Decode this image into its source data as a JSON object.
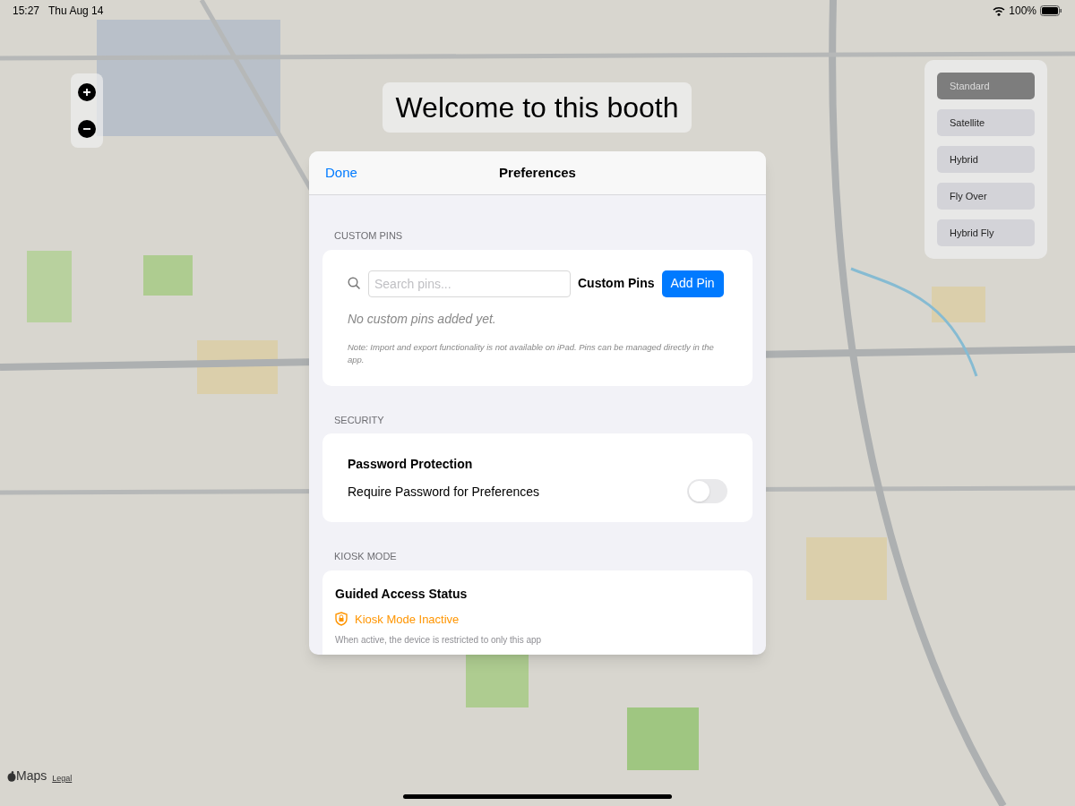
{
  "status_bar": {
    "time": "15:27",
    "date": "Thu Aug 14",
    "battery": "100%"
  },
  "banner": {
    "title": "Welcome to this booth"
  },
  "map_types": [
    {
      "label": "Standard",
      "selected": true
    },
    {
      "label": "Satellite",
      "selected": false
    },
    {
      "label": "Hybrid",
      "selected": false
    },
    {
      "label": "Fly Over",
      "selected": false
    },
    {
      "label": "Hybrid Fly",
      "selected": false
    }
  ],
  "attribution": {
    "brand": "Maps",
    "legal": "Legal"
  },
  "sheet": {
    "done": "Done",
    "title": "Preferences",
    "custom_pins": {
      "header": "CUSTOM PINS",
      "search_placeholder": "Search pins...",
      "title": "Custom Pins",
      "add_button": "Add Pin",
      "empty": "No custom pins added yet.",
      "note": "Note: Import and export functionality is not available on iPad. Pins can be managed directly in the app."
    },
    "security": {
      "header": "SECURITY",
      "title": "Password Protection",
      "label": "Require Password for Preferences",
      "on": false
    },
    "kiosk": {
      "header": "KIOSK MODE",
      "title": "Guided Access Status",
      "status": "Kiosk Mode Inactive",
      "active": false,
      "note": "When active, the device is restricted to only this app"
    }
  }
}
